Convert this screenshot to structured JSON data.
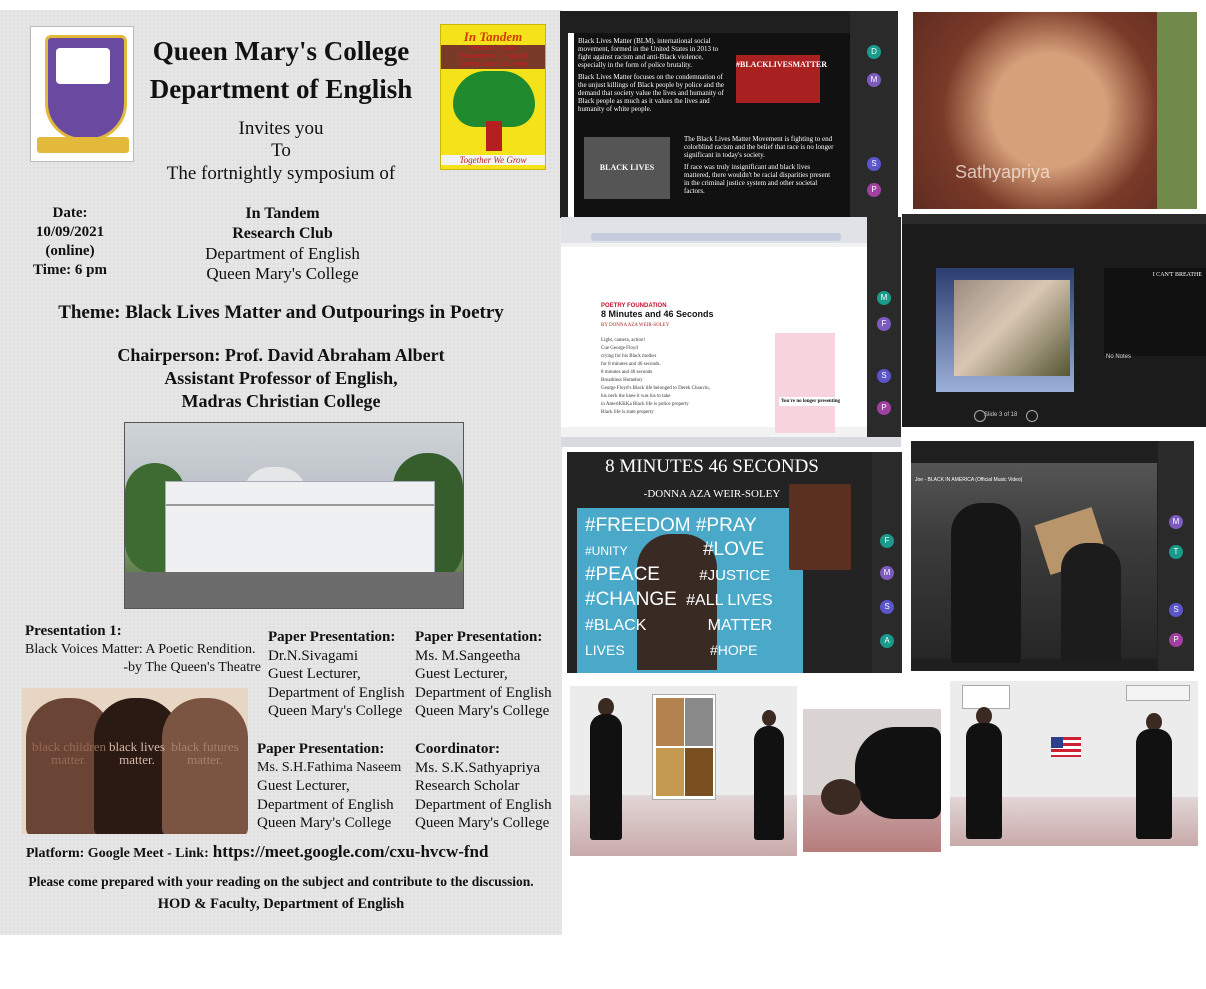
{
  "poster": {
    "college": "Queen Mary's College",
    "department": "Department of English",
    "invite_lines": [
      "Invites you",
      "To",
      "The fortnightly symposium of"
    ],
    "logo_right": {
      "name": "In Tandem",
      "lines": [
        "Research Club,",
        "Department of English",
        "Queen Mary's College"
      ],
      "motto": "Together We Grow"
    },
    "date": {
      "label": "Date:",
      "value": "10/09/2021",
      "mode": "(online)",
      "time": "Time: 6 pm"
    },
    "host": {
      "name": "In Tandem",
      "club": "Research Club",
      "dept": "Department of English",
      "college": "Queen Mary's College"
    },
    "theme": "Theme: Black Lives Matter and Outpourings in Poetry",
    "chair": {
      "line1": "Chairperson: Prof. David Abraham Albert",
      "line2": "Assistant Professor of English,",
      "line3": "Madras Christian College"
    },
    "presentation1": {
      "heading": "Presentation 1:",
      "title": "Black Voices Matter: A Poetic Rendition.",
      "by": "-by The Queen's Theatre"
    },
    "paper1": {
      "heading": "Paper Presentation:",
      "name": "Dr.N.Sivagami",
      "role": "Guest Lecturer,",
      "dept": "Department of English",
      "college": "Queen Mary's College"
    },
    "paper2": {
      "heading": "Paper Presentation:",
      "name": "Ms. M.Sangeetha",
      "role": "Guest Lecturer,",
      "dept": "Department of English",
      "college": "Queen Mary's College"
    },
    "paper3": {
      "heading": "Paper Presentation:",
      "name": "Ms. S.H.Fathima Naseem",
      "role": "Guest Lecturer,",
      "dept": "Department of English",
      "college": "Queen Mary's College"
    },
    "coordinator": {
      "heading": "Coordinator:",
      "name": "Ms. S.K.Sathyapriya",
      "role": "Research Scholar",
      "dept": "Department of English",
      "college": "Queen Mary's College"
    },
    "blm_art": [
      "black children matter.",
      "black lives matter.",
      "black futures matter."
    ],
    "platform_label": "Platform: Google Meet  - Link:",
    "platform_link": "https://meet.google.com/cxu-hvcw-fnd",
    "footer1": "Please come prepared with your reading on the subject and contribute to the discussion.",
    "footer2": "HOD & Faculty, Department of English"
  },
  "tiles": {
    "slide_blm": {
      "para1": "Black Lives Matter (BLM), international social movement, formed in the United States in 2013 to fight against racism and anti-Black violence, especially in the form of police brutality.",
      "para2": "Black Lives Matter focuses on the condemnation of the unjust killings of Black people by police and the demand that society value the lives and humanity of Black people as much as it values the lives and humanity of white people.",
      "para3": "The Black Lives Matter Movement is fighting to end colorblind racism and the belief that race is no longer significant in today's society.",
      "para4": "If race was truly insignificant and black lives mattered, there wouldn't be racial disparities present in the criminal justice system and other societal factors.",
      "hashtag": "#BLACKLIVESMATTER",
      "sign": "BLACK LIVES MATTER",
      "participants": [
        "D",
        "M",
        "S",
        "P"
      ]
    },
    "webcam": {
      "name": "Sathyapriya"
    },
    "browser": {
      "brand": "POETRY FOUNDATION",
      "poem_title": "8 Minutes and 46 Seconds",
      "author": "BY DONNA AZA WEIR-SOLEY",
      "lines": [
        "Light, camera, action!",
        "Cue George Floyd",
        "crying for his Black mother",
        "for 8 minutes and 46 seconds.",
        "8 minutes and 46 seconds",
        "Breathless Homeboy",
        "George Floyd's Black life belonged to Derek Chauvin,",
        "his neck the knee it was his to take",
        "in AmeriKKKa Black life is police property",
        "Black life is state property"
      ],
      "notify": "You're no longer presenting",
      "participants": [
        "M",
        "F",
        "S",
        "P"
      ]
    },
    "present": {
      "slide_title": "I CAN'T BREATHE",
      "notes": "No Notes",
      "counter": "Slide 3 of 18"
    },
    "mural": {
      "title": "8 MINUTES 46 SECONDS",
      "author": "-DONNA AZA WEIR-SOLEY",
      "words": [
        "#FREEDOM",
        "#PRAY",
        "#UNITY",
        "#LOVE",
        "#PEACE",
        "#JUSTICE",
        "#CHANGE",
        "#ALL LIVES",
        "#BLACK",
        "MATTER",
        "LIVES",
        "#HOPE"
      ],
      "participants": [
        "F",
        "M",
        "S",
        "A"
      ]
    },
    "video": {
      "caption": "Joe - BLACK IN AMERICA (Official Music Video)",
      "participants": [
        "M",
        "T",
        "S",
        "P"
      ]
    }
  },
  "colors": {
    "poster_bg": "#e6e6e6",
    "meet_dark": "#202124",
    "tandem_yellow": "#f4e21a",
    "seal_purple": "#6a4aa0"
  }
}
